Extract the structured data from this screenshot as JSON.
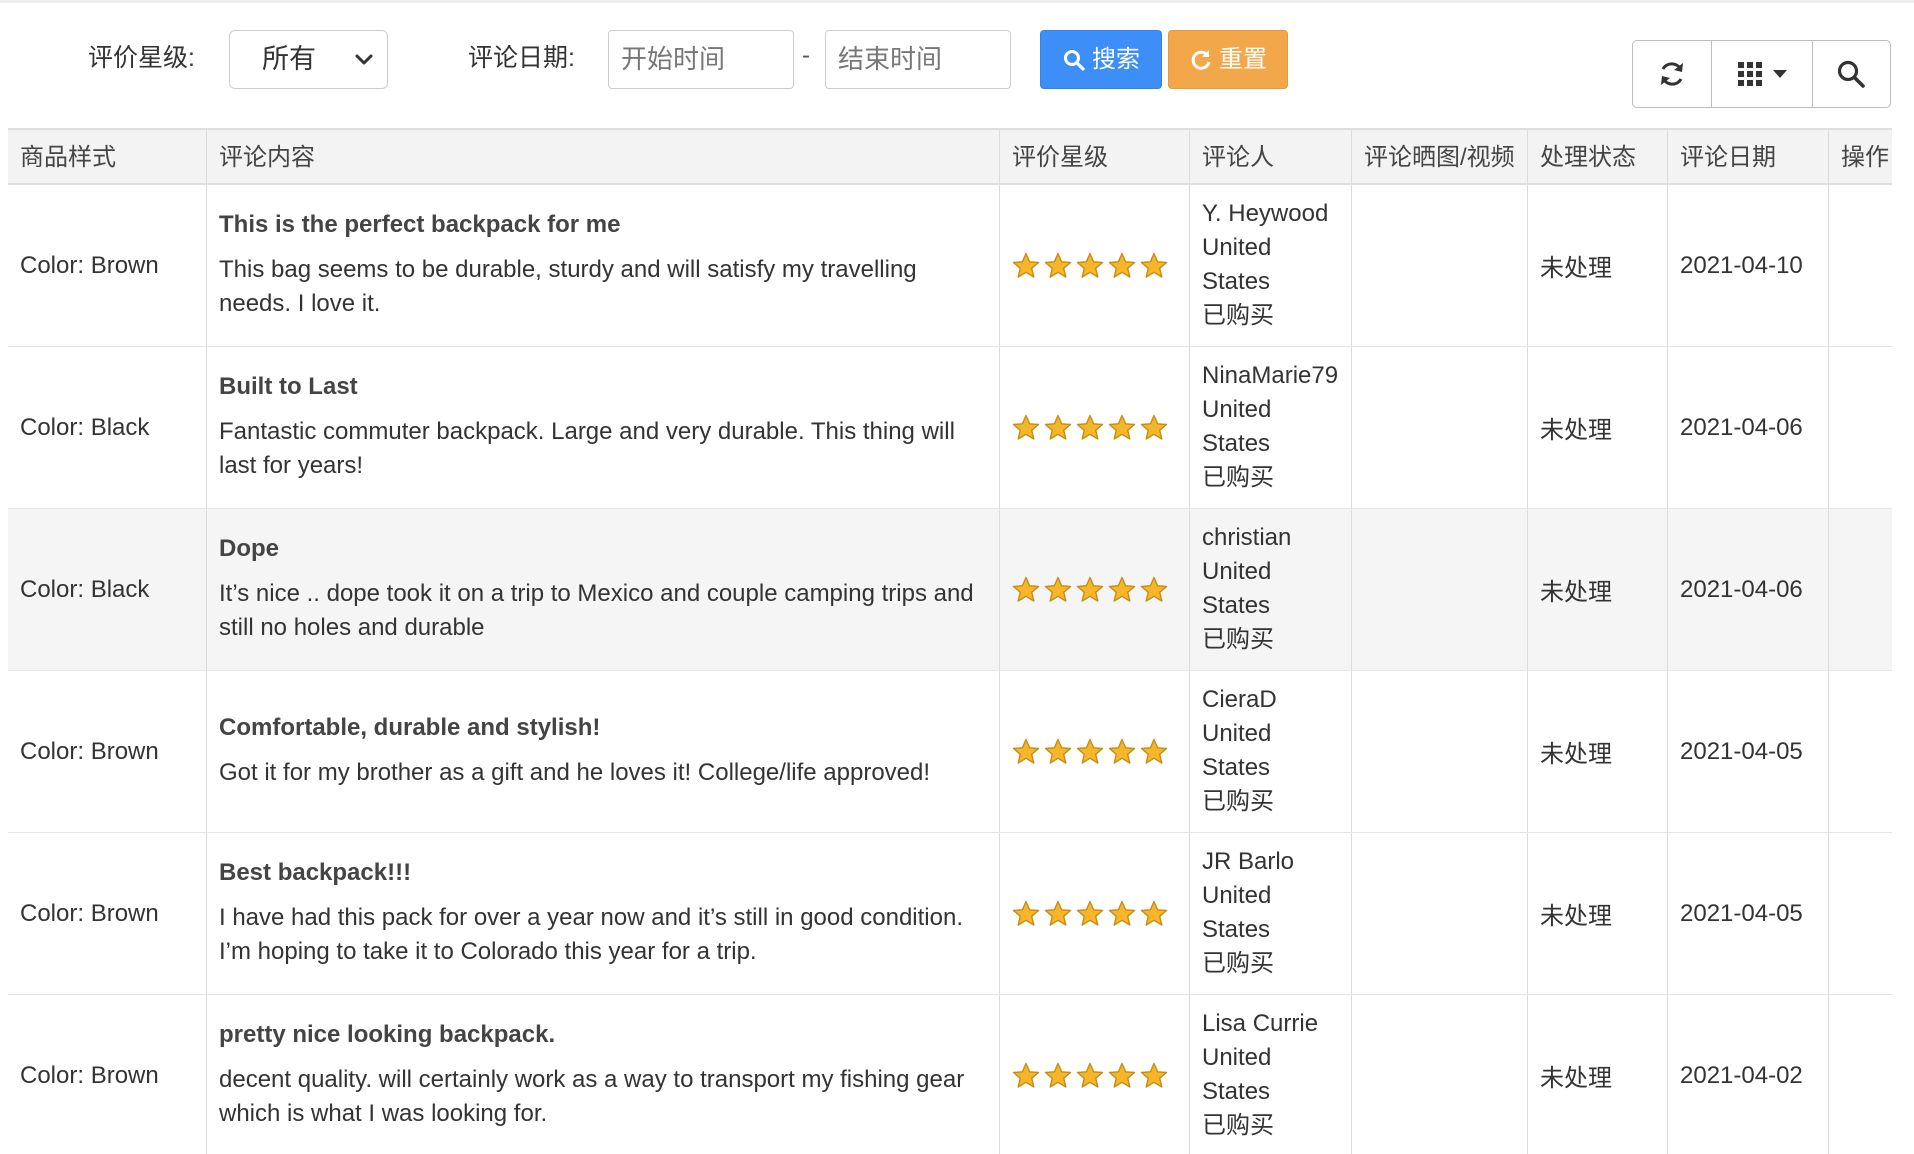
{
  "toolbar": {
    "rating_label": "评价星级:",
    "rating_select": "所有",
    "date_label": "评论日期:",
    "start_placeholder": "开始时间",
    "end_placeholder": "结束时间",
    "range_sep": "-",
    "search_label": "搜索",
    "reset_label": "重置"
  },
  "columns": [
    "商品样式",
    "评论内容",
    "评价星级",
    "评论人",
    "评论晒图/视频",
    "处理状态",
    "评论日期",
    "操作"
  ],
  "rows": [
    {
      "style": "Color: Brown",
      "title": "This is the perfect backpack for me",
      "body": "This bag seems to be durable, sturdy and will satisfy my travelling needs. I love it.",
      "rating": 5,
      "reviewer": "Y. Heywood",
      "country": "United States",
      "purchased": "已购买",
      "status": "未处理",
      "date": "2021-04-10"
    },
    {
      "style": "Color: Black",
      "title": "Built to Last",
      "body": "Fantastic commuter backpack. Large and very durable. This thing will last for years!",
      "rating": 5,
      "reviewer": "NinaMarie79",
      "country": "United States",
      "purchased": "已购买",
      "status": "未处理",
      "date": "2021-04-06"
    },
    {
      "style": "Color: Black",
      "title": "Dope",
      "body": "It’s nice .. dope took it on a trip to Mexico and couple camping trips and still no holes and durable",
      "rating": 5,
      "reviewer": "christian",
      "country": "United States",
      "purchased": "已购买",
      "status": "未处理",
      "date": "2021-04-06"
    },
    {
      "style": "Color: Brown",
      "title": "Comfortable, durable and stylish!",
      "body": "Got it for my brother as a gift and he loves it! College/life approved!",
      "rating": 5,
      "reviewer": "CieraD",
      "country": "United States",
      "purchased": "已购买",
      "status": "未处理",
      "date": "2021-04-05"
    },
    {
      "style": "Color: Brown",
      "title": "Best backpack!!!",
      "body": "I have had this pack for over a year now and it’s still in good condition. I’m hoping to take it to Colorado this year for a trip.",
      "rating": 5,
      "reviewer": "JR Barlo",
      "country": "United States",
      "purchased": "已购买",
      "status": "未处理",
      "date": "2021-04-05"
    },
    {
      "style": "Color: Brown",
      "title": "pretty nice looking backpack.",
      "body": "decent quality. will certainly work as a way to transport my fishing gear which is what I was looking for.",
      "rating": 5,
      "reviewer": "Lisa Currie",
      "country": "United States",
      "purchased": "已购买",
      "status": "未处理",
      "date": "2021-04-02"
    }
  ],
  "icons": {
    "search": "search-icon",
    "reset": "refresh-icon",
    "refresh": "refresh-icon",
    "columns": "grid-icon",
    "find": "search-icon",
    "star": "star-icon"
  },
  "colors": {
    "search_button": "#3e8ef7",
    "reset_button": "#f2a84a",
    "star": "#f5b62a",
    "header_bg": "#f3f3f4",
    "alt_row_bg": "#f5f5f5"
  }
}
